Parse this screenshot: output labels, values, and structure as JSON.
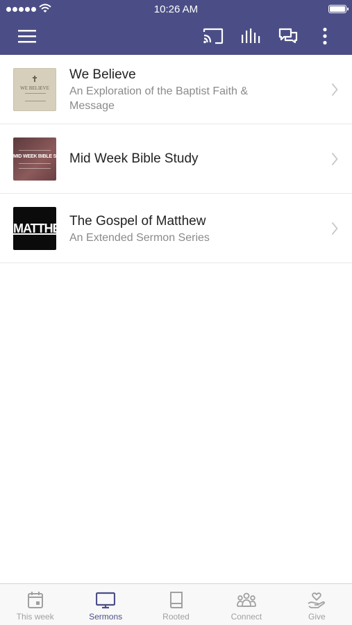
{
  "status_bar": {
    "time": "10:26 AM"
  },
  "colors": {
    "header": "#4b4e86",
    "accent": "#4b4e86",
    "inactive_tab": "#a0a0a0"
  },
  "toolbar": {
    "icons": [
      "menu-icon",
      "cast-icon",
      "equalizer-icon",
      "chat-icon",
      "more-vert-icon"
    ]
  },
  "series": [
    {
      "title": "We Believe",
      "subtitle": "An Exploration of the Baptist Faith & Message",
      "thumbnail_text": "WE BELIEVE"
    },
    {
      "title": "Mid Week Bible Study",
      "subtitle": "",
      "thumbnail_text": "MID WEEK BIBLE STUDY"
    },
    {
      "title": "The Gospel of Matthew",
      "subtitle": "An Extended Sermon Series",
      "thumbnail_text": "MATTHEW"
    }
  ],
  "tabs": [
    {
      "label": "This week",
      "icon": "calendar-icon",
      "active": false
    },
    {
      "label": "Sermons",
      "icon": "monitor-icon",
      "active": true
    },
    {
      "label": "Rooted",
      "icon": "book-icon",
      "active": false
    },
    {
      "label": "Connect",
      "icon": "people-icon",
      "active": false
    },
    {
      "label": "Give",
      "icon": "heart-hand-icon",
      "active": false
    }
  ]
}
